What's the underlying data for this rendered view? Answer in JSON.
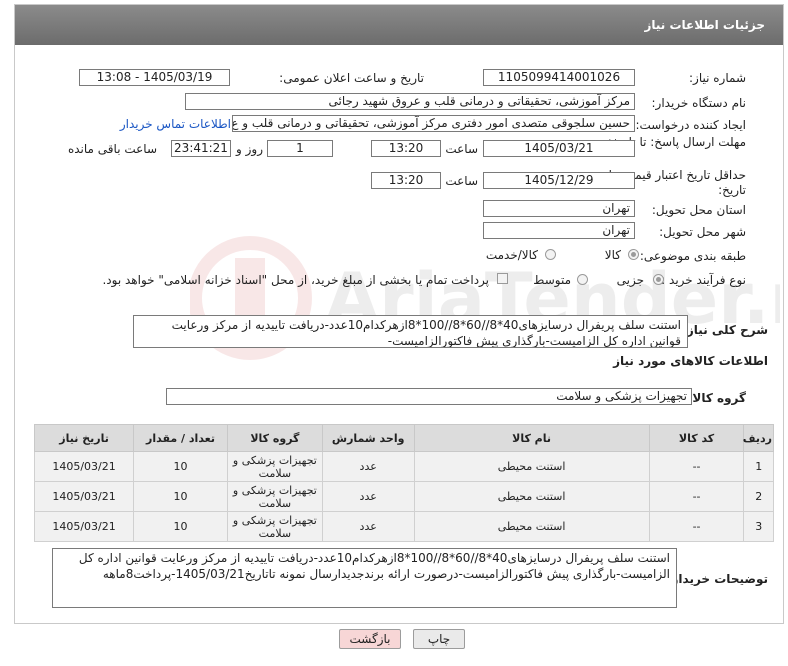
{
  "header": {
    "title": "جزئیات اطلاعات نیاز"
  },
  "fields": {
    "need_number_label": "شماره نیاز:",
    "need_number": "1105099414001026",
    "announce_label": "تاریخ و ساعت اعلان عمومی:",
    "announce_value": "1405/03/19 - 13:08",
    "buyer_org_label": "نام دستگاه خریدار:",
    "buyer_org": "مرکز آموزشی، تحقیقاتی و درمانی قلب و عروق شهید رجائی",
    "creator_label": "ایجاد کننده درخواست:",
    "creator": "حسین سلجوقی متصدی امور دفتری مرکز آموزشی، تحقیقاتی و درمانی قلب و ع",
    "contact_link": "اطلاعات تماس خریدار",
    "deadline_label": "مهلت ارسال پاسخ: تا تاریخ:",
    "deadline_date": "1405/03/21",
    "time_label": "ساعت",
    "deadline_time": "13:20",
    "days_value": "1",
    "days_label": "روز و",
    "remaining_time": "23:41:21",
    "remaining_label": "ساعت باقی مانده",
    "validity_label": "حداقل تاریخ اعتبار قیمت: تا تاریخ:",
    "validity_date": "1405/12/29",
    "validity_time": "13:20",
    "province_label": "استان محل تحویل:",
    "province": "تهران",
    "city_label": "شهر محل تحویل:",
    "city": "تهران",
    "category_label": "طبقه بندی موضوعی:",
    "category_options": [
      "کالا",
      "کالا/خدمت"
    ],
    "process_label": "نوع فرآیند خرید :",
    "process_options": [
      "جزیی",
      "متوسط"
    ],
    "payment_note": "پرداخت تمام یا بخشی از مبلغ خرید، از محل \"اسناد خزانه اسلامی\" خواهد بود."
  },
  "summary": {
    "label": "شرح کلی نیاز:",
    "text": "استنت سلف پریفرال درسایزهای40*8//60*8//100*8ازهرکدام10عدد-دریافت تاییدیه از مرکز ورعایت قوانین اداره کل الزامیست-بارگذاری پیش فاکتورالزامیست-"
  },
  "goods_info": {
    "title": "اطلاعات کالاهای مورد نیاز",
    "group_label": "گروه کالا:",
    "group_value": "تجهیزات پزشکی و سلامت"
  },
  "table": {
    "headers": [
      "ردیف",
      "کد کالا",
      "نام کالا",
      "واحد شمارش",
      "گروه کالا",
      "تعداد / مقدار",
      "تاریخ نیاز"
    ],
    "rows": [
      [
        "1",
        "--",
        "استنت محیطی",
        "عدد",
        "تجهیزات پزشکی و سلامت",
        "10",
        "1405/03/21"
      ],
      [
        "2",
        "--",
        "استنت محیطی",
        "عدد",
        "تجهیزات پزشکی و سلامت",
        "10",
        "1405/03/21"
      ],
      [
        "3",
        "--",
        "استنت محیطی",
        "عدد",
        "تجهیزات پزشکی و سلامت",
        "10",
        "1405/03/21"
      ]
    ]
  },
  "buyer_notes": {
    "label": "توضیحات خریدار:",
    "text": "استنت سلف پریفرال درسایزهای40*8//60*8//100*8ازهرکدام10عدد-دریافت تاییدیه از مرکز ورعایت قوانین اداره کل الزامیست-بارگذاری پیش فاکتورالزامیست-درصورت ارائه برندجدیدارسال نمونه تاتاریخ1405/03/21-پرداخت8ماهه"
  },
  "buttons": {
    "print": "چاپ",
    "back": "بازگشت"
  },
  "colors": {
    "header_bg": "#7a7a7a",
    "link": "#1a56c4",
    "back_button_bg": "#f7d6d6",
    "print_button_bg": "#eaeaea"
  }
}
